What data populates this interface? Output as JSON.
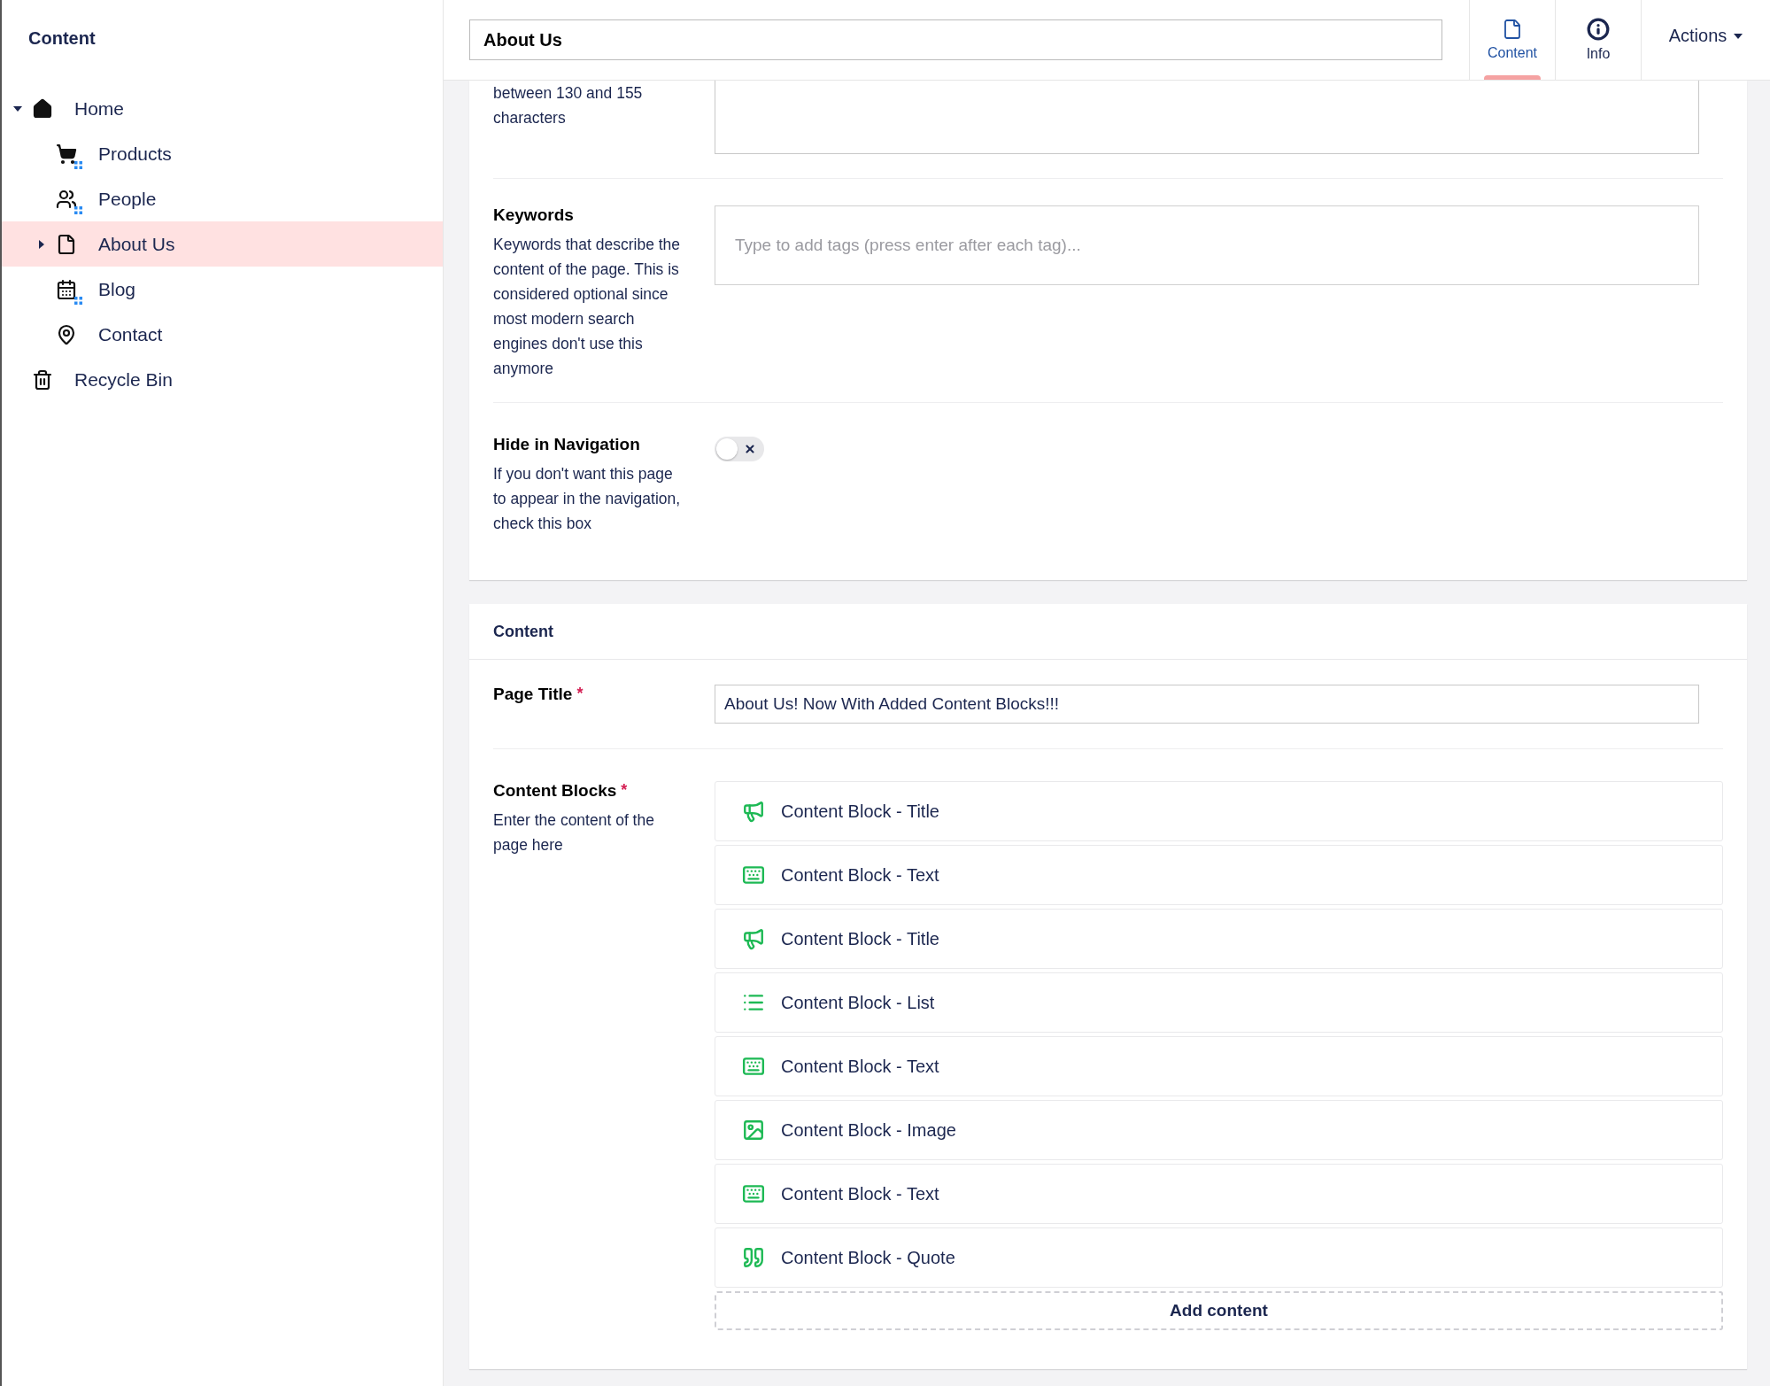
{
  "sidebar": {
    "title": "Content",
    "tree": [
      {
        "label": "Home",
        "kind": "home",
        "expanded": true,
        "selected": false,
        "children": [
          {
            "label": "Products",
            "kind": "cart",
            "selected": false
          },
          {
            "label": "People",
            "kind": "people",
            "selected": false
          },
          {
            "label": "About Us",
            "kind": "page",
            "expanded": false,
            "selected": true
          },
          {
            "label": "Blog",
            "kind": "calendar",
            "selected": false
          },
          {
            "label": "Contact",
            "kind": "pin",
            "selected": false
          }
        ]
      },
      {
        "label": "Recycle Bin",
        "kind": "trash",
        "selected": false
      }
    ]
  },
  "header": {
    "name_value": "About Us",
    "tabs": [
      {
        "label": "Content",
        "kind": "page",
        "selected": true
      },
      {
        "label": "Info",
        "kind": "info",
        "selected": false
      }
    ],
    "actions": "Actions"
  },
  "seo_panel": {
    "description_tail": "between 130 and 155 characters",
    "keywords": {
      "label": "Keywords",
      "description": "Keywords that describe the content of the page. This is considered optional since most modern search engines don't use this anymore",
      "placeholder": "Type to add tags (press enter after each tag)..."
    },
    "hide_in_navigation": {
      "label": "Hide in Navigation",
      "description": "If you don't want this page to appear in the navigation, check this box",
      "on": false
    }
  },
  "content_panel": {
    "title": "Content",
    "page_title": {
      "label": "Page Title",
      "required_mark": "*",
      "value": "About Us! Now With Added Content Blocks!!!"
    },
    "content_blocks": {
      "label": "Content Blocks",
      "required_mark": "*",
      "description": "Enter the content of the page here",
      "blocks": [
        {
          "label": "Content Block - Title",
          "kind": "title"
        },
        {
          "label": "Content Block - Text",
          "kind": "text"
        },
        {
          "label": "Content Block - Title",
          "kind": "title"
        },
        {
          "label": "Content Block - List",
          "kind": "list"
        },
        {
          "label": "Content Block - Text",
          "kind": "text"
        },
        {
          "label": "Content Block - Image",
          "kind": "image"
        },
        {
          "label": "Content Block - Text",
          "kind": "text"
        },
        {
          "label": "Content Block - Quote",
          "kind": "quote"
        }
      ],
      "add_button": "Add content"
    }
  }
}
